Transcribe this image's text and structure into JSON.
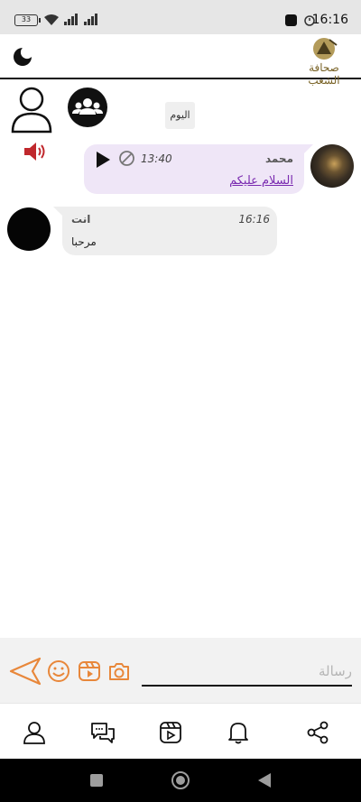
{
  "status_bar": {
    "battery": "33",
    "time": "16:16"
  },
  "header": {
    "logo_text": "صحافة الشعب"
  },
  "chat": {
    "day_label": "اليوم",
    "messages": [
      {
        "sender": "محمد",
        "time": "13:40",
        "text": "السلام عليكم"
      },
      {
        "sender": "انت",
        "time": "16:16",
        "text": "مرحبا"
      }
    ]
  },
  "composer": {
    "placeholder": "رسالة"
  },
  "icons": {
    "header": [
      "moon-icon",
      "logo"
    ],
    "top": [
      "user-outline-icon",
      "group-icon",
      "speaker-icon"
    ],
    "message": [
      "play-icon",
      "ban-icon"
    ],
    "composer": [
      "send-icon",
      "emoji-icon",
      "video-icon",
      "camera-icon"
    ],
    "bottom_nav": [
      "profile-icon",
      "chats-icon",
      "reels-icon",
      "notifications-icon",
      "share-icon"
    ],
    "system_nav": [
      "recents-icon",
      "home-icon",
      "back-icon"
    ]
  },
  "colors": {
    "accent_orange": "#e8873a",
    "incoming_bubble": "#efe6f7",
    "outgoing_bubble": "#eeeeee",
    "link_purple": "#7a2bb0",
    "speaker_red": "#c0282d"
  }
}
